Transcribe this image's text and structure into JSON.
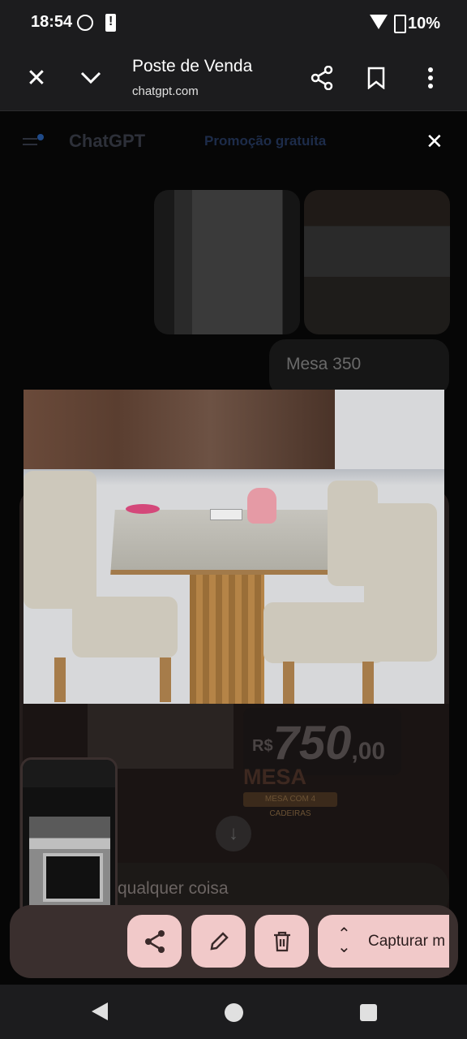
{
  "status_bar": {
    "time": "18:54",
    "battery": "10%"
  },
  "toolbar": {
    "page_title": "Poste de Venda",
    "url": "chatgpt.com"
  },
  "chat_page": {
    "app_title": "ChatGPT",
    "promo_label": "Promoção gratuita",
    "user_message": "Mesa 350",
    "input_placeholder": "qualquer coisa"
  },
  "poster": {
    "currency": "R$",
    "price_whole": "750",
    "price_cents": ",00",
    "product_title": "MESA",
    "product_subtitle": "MESA COM 4 CADEIRAS"
  },
  "screenshot_actions": {
    "capture_label": "Capturar m"
  },
  "icons": {
    "close": "close-icon",
    "expand": "chevron-down-icon",
    "share": "share-icon",
    "bookmark": "bookmark-icon",
    "menu": "more-vert-icon",
    "edit": "pencil-icon",
    "delete": "trash-icon",
    "capture": "expand-vertical-icon"
  },
  "colors": {
    "action_button": "#f1c9c9",
    "action_bar": "#3a2f2e",
    "system_bar": "#1c1c1e"
  }
}
